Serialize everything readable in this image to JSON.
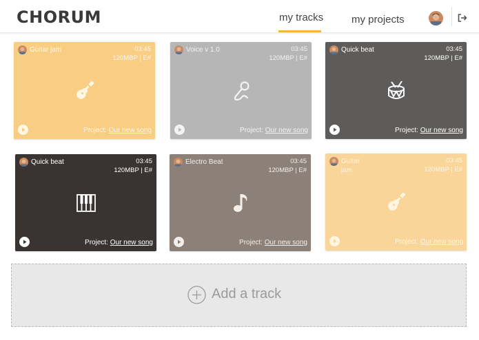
{
  "app": {
    "logo": "CHORUM",
    "tabs": [
      {
        "label": "my tracks",
        "active": true
      },
      {
        "label": "my projects",
        "active": false
      }
    ],
    "accent_color": "#f4b540"
  },
  "tracks": [
    {
      "title": "Guitar jam",
      "time": "03:45",
      "meta": "120MBP | E#",
      "project_prefix": "Project:",
      "project_name": "Our new song",
      "icon": "guitar-icon",
      "color": "#f8ce85"
    },
    {
      "title": "Voice v 1.0",
      "time": "03:45",
      "meta": "120MBP | E#",
      "project_prefix": "Project:",
      "project_name": "Our new song",
      "icon": "microphone-icon",
      "color": "#b6b6b6"
    },
    {
      "title": "Quick beat",
      "time": "03:45",
      "meta": "120MBP | E#",
      "project_prefix": "Project:",
      "project_name": "Our new song",
      "icon": "drum-icon",
      "color": "#5e5c5a"
    },
    {
      "title": "Quick beat",
      "time": "03:45",
      "meta": "120MBP | E#",
      "project_prefix": "Project:",
      "project_name": "Our new song",
      "icon": "piano-icon",
      "color": "#393431"
    },
    {
      "title": "Electro Beat",
      "time": "03:45",
      "meta": "120MBP | E#",
      "project_prefix": "Project:",
      "project_name": "Our new song",
      "icon": "music-note-icon",
      "color": "#8c8178"
    },
    {
      "title": "Guitar jam",
      "time": "03:45",
      "meta": "120MBP | E#",
      "project_prefix": "Project:",
      "project_name": "Our new song",
      "icon": "guitar-icon",
      "color": "#fad59a"
    }
  ],
  "add_track": {
    "label": "Add a track"
  }
}
